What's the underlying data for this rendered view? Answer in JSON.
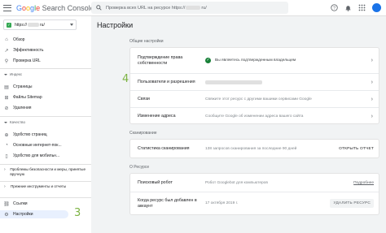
{
  "header": {
    "logo_google": [
      "G",
      "o",
      "o",
      "g",
      "l",
      "e"
    ],
    "logo_product": "Search Console",
    "search_placeholder": "Проверка всех URL на ресурсе https://",
    "search_suffix": "ru/"
  },
  "sidebar": {
    "property": "https://",
    "property_suffix": "ru/",
    "items": [
      {
        "label": "Обзор",
        "icon": "home-icon"
      },
      {
        "label": "Эффективность",
        "icon": "trend-icon"
      },
      {
        "label": "Проверка URL",
        "icon": "search-icon"
      }
    ],
    "index_section": "Индекс",
    "index_items": [
      {
        "label": "Страницы",
        "icon": "pages-icon"
      },
      {
        "label": "Файлы Sitemap",
        "icon": "sitemap-icon"
      },
      {
        "label": "Удаления",
        "icon": "removals-icon"
      }
    ],
    "quality_section": "Качество",
    "quality_items": [
      {
        "label": "Удобство страниц",
        "icon": "page-experience-icon"
      },
      {
        "label": "Основные интернет-пок...",
        "icon": "web-vitals-icon"
      },
      {
        "label": "Удобство для мобильн...",
        "icon": "mobile-icon"
      }
    ],
    "security_item": "Проблемы безопасности и меры, принятые вручную",
    "legacy_item": "Прежние инструменты и отчеты",
    "links_item": "Ссылки",
    "settings_item": "Настройки"
  },
  "main": {
    "title": "Настройки",
    "general_label": "Общие настройки",
    "general_rows": [
      {
        "label": "Подтверждение права собственности",
        "value": "Вы являетесь подтвержденным владельцем"
      },
      {
        "label": "Пользователи и разрешения",
        "value": ""
      },
      {
        "label": "Связи",
        "value": "Свяжите этот ресурс с другими вашими сервисами Google"
      },
      {
        "label": "Изменение адреса",
        "value": "Сообщите Google об изменении адреса вашего сайта"
      }
    ],
    "crawl_label": "Сканирование",
    "crawl_row": {
      "label": "Статистика сканирования",
      "value": "138 запросов сканирования за последние 90 дней",
      "action": "ОТКРЫТЬ ОТЧЕТ"
    },
    "about_label": "О Ресурсе",
    "about_rows": [
      {
        "label": "Поисковый робот",
        "value": "Робот Googlebot для компьютеров",
        "action": "Подробнее"
      },
      {
        "label": "Когда ресурс был добавлен в аккаунт",
        "value": "17 октября 2019 г.",
        "action": "УДАЛИТЬ РЕСУРС"
      }
    ]
  },
  "annotations": {
    "three": "3",
    "four": "4"
  },
  "colors": {
    "accent": "#1a73e8",
    "success": "#188038",
    "annotation": "#7cb342",
    "active_bg": "#e8f0fe"
  }
}
